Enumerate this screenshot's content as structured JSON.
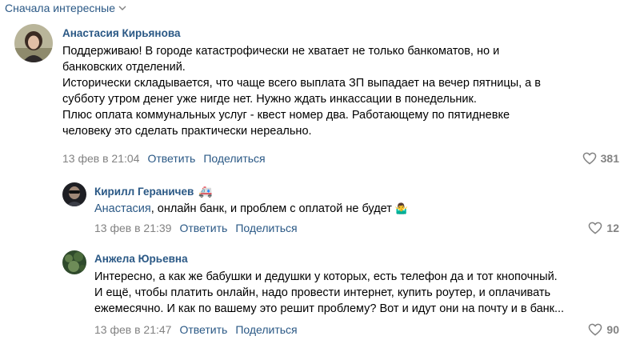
{
  "sort": {
    "label": "Сначала интересные",
    "icon": "chevron-down-icon"
  },
  "comments": [
    {
      "author": "Анастасия Кирьянова",
      "lines": [
        "Поддерживаю! В городе катастрофически не хватает не только банкоматов, но и",
        "банковских отделений.",
        "Исторически складывается, что чаще всего выплата ЗП выпадает на вечер пятницы, а в",
        "субботу утром денег уже нигде нет. Нужно ждать инкассации в понедельник.",
        "Плюс оплата коммунальных услуг - квест номер два. Работающему по пятидневке",
        "человеку это сделать практически нереально."
      ],
      "date": "13 фев в 21:04",
      "reply": "Ответить",
      "share": "Поделиться",
      "likes": "381"
    },
    {
      "author": "Кирилл Гераничев",
      "author_emoji": "🚑",
      "reply_to": "Анастасия",
      "text": ", онлайн банк, и проблем с оплатой не будет",
      "text_emoji": "🤷‍♂️",
      "date": "13 фев в 21:39",
      "reply": "Ответить",
      "share": "Поделиться",
      "likes": "12"
    },
    {
      "author": "Анжела Юрьевна",
      "lines": [
        "Интересно, а как же бабушки и дедушки у которых, есть телефон да и тот кнопочный.",
        "И ещё, чтобы платить онлайн, надо провести интернет, купить роутер, и оплачивать",
        "ежемесячно. И как по вашему это решит проблему? Вот и идут они на почту и в банк..."
      ],
      "date": "13 фев в 21:47",
      "reply": "Ответить",
      "share": "Поделиться",
      "likes": "90"
    }
  ],
  "colors": {
    "link": "#2a5885",
    "meta": "#828282",
    "text": "#000000"
  }
}
